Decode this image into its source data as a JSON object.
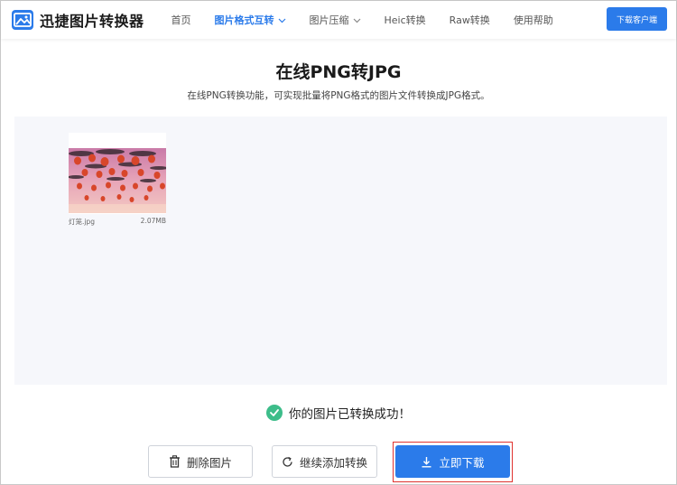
{
  "app": {
    "name": "迅捷图片转换器"
  },
  "nav": {
    "items": [
      {
        "label": "首页",
        "active": false,
        "dropdown": false
      },
      {
        "label": "图片格式互转",
        "active": true,
        "dropdown": true
      },
      {
        "label": "图片压缩",
        "active": false,
        "dropdown": true
      },
      {
        "label": "Heic转换",
        "active": false,
        "dropdown": false
      },
      {
        "label": "Raw转换",
        "active": false,
        "dropdown": false
      },
      {
        "label": "使用帮助",
        "active": false,
        "dropdown": false
      }
    ],
    "download_client": "下载客户端"
  },
  "page": {
    "title": "在线PNG转JPG",
    "subtitle": "在线PNG转换功能，可实现批量将PNG格式的图片文件转换成JPG格式。"
  },
  "file": {
    "name": "灯笼.jpg",
    "size": "2.07MB"
  },
  "status": {
    "message": "你的图片已转换成功！"
  },
  "actions": {
    "delete": "删除图片",
    "continue": "继续添加转换",
    "download": "立即下载"
  },
  "colors": {
    "accent": "#2b7bea",
    "success": "#3dbd8a",
    "highlight": "#e0332f",
    "work_area_bg": "#f6f7fb"
  }
}
